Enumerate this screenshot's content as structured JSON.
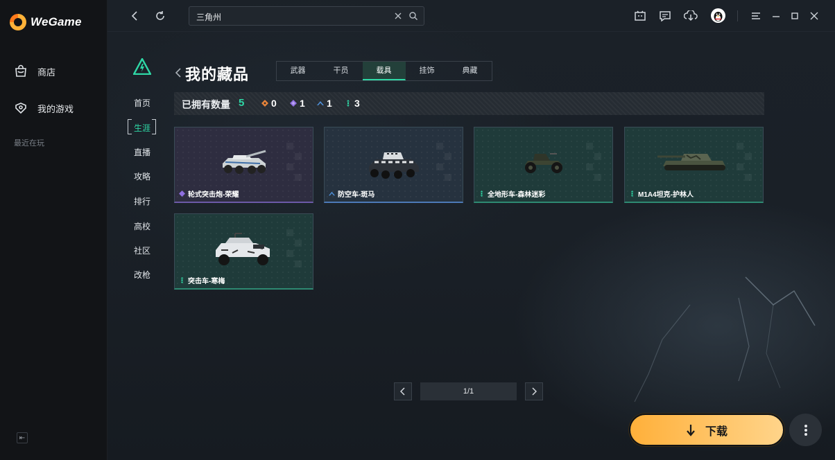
{
  "app": {
    "brand": "WeGame",
    "nav": [
      {
        "label": "商店",
        "icon": "store-bag-icon"
      },
      {
        "label": "我的游戏",
        "icon": "gamepad-icon"
      }
    ],
    "recent_label": "最近在玩"
  },
  "topbar": {
    "search_value": "三角州"
  },
  "game_nav": {
    "items": [
      "首页",
      "生涯",
      "直播",
      "攻略",
      "排行",
      "高校",
      "社区",
      "改枪"
    ],
    "active": "生涯"
  },
  "content": {
    "title": "我的藏品",
    "tabs": [
      "武器",
      "干员",
      "载具",
      "挂饰",
      "典藏"
    ],
    "active_tab": "载具",
    "stats": {
      "label": "已拥有数量",
      "total": "5",
      "counts": [
        {
          "tier": "orange",
          "color": "#e8843a",
          "value": "0"
        },
        {
          "tier": "purple",
          "color": "#8f6fe0",
          "value": "1"
        },
        {
          "tier": "blue",
          "color": "#4f8fd8",
          "value": "1"
        },
        {
          "tier": "green",
          "color": "#2fd8a6",
          "value": "3"
        }
      ]
    },
    "items": [
      {
        "name": "轮式突击炮-荣耀",
        "tier": "purple"
      },
      {
        "name": "防空车-斑马",
        "tier": "blue"
      },
      {
        "name": "全地形车-森林迷彩",
        "tier": "green"
      },
      {
        "name": "M1A4坦克-护林人",
        "tier": "green"
      },
      {
        "name": "突击车-寒梅",
        "tier": "green"
      }
    ],
    "pagination": "1/1"
  },
  "actions": {
    "download_label": "下载"
  }
}
